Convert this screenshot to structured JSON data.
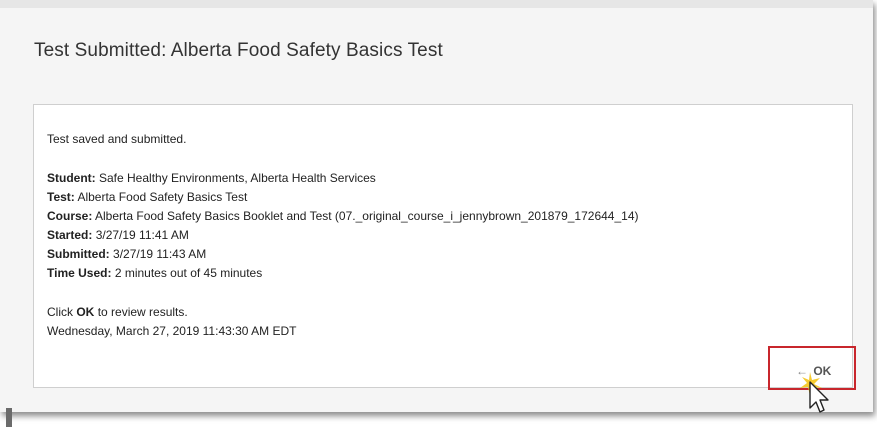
{
  "dialog": {
    "title": "Test Submitted: Alberta Food Safety Basics Test"
  },
  "receipt": {
    "status": "Test saved and submitted.",
    "student_label": "Student:",
    "student_value": "Safe Healthy Environments, Alberta Health Services",
    "test_label": "Test:",
    "test_value": "Alberta Food Safety Basics Test",
    "course_label": "Course:",
    "course_value": "Alberta Food Safety Basics Booklet and Test (07._original_course_i_jennybrown_201879_172644_14)",
    "started_label": "Started:",
    "started_value": "3/27/19 11:41 AM",
    "submitted_label": "Submitted:",
    "submitted_value": "3/27/19 11:43 AM",
    "time_used_label": "Time Used:",
    "time_used_value": "2 minutes out of 45 minutes",
    "review_prefix": "Click",
    "review_ok": "OK",
    "review_suffix": "to review results.",
    "timestamp": "Wednesday, March 27, 2019 11:43:30 AM EDT"
  },
  "actions": {
    "ok_arrow": "←",
    "ok_label": "OK"
  },
  "colors": {
    "highlight": "#c8262c",
    "cursor_glow": "#f5c518"
  }
}
